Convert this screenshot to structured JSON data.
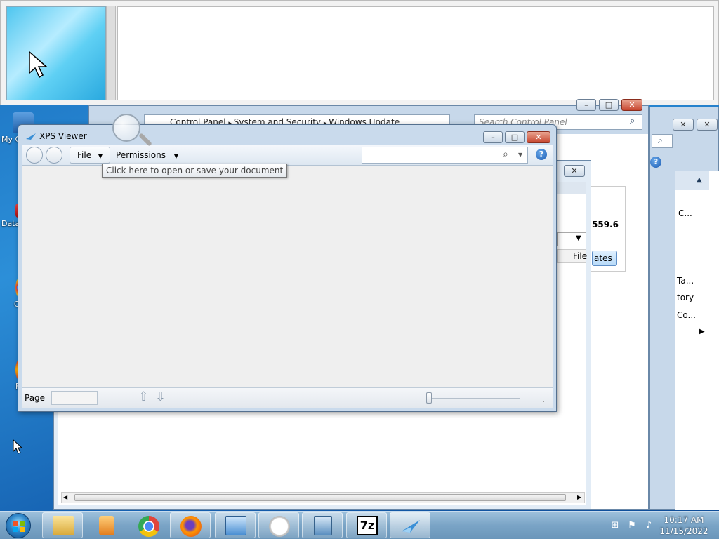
{
  "desktop": {
    "icons": [
      {
        "label": "My C"
      },
      {
        "label": "Data"
      },
      {
        "label": "C"
      },
      {
        "label": "F"
      }
    ]
  },
  "control_panel": {
    "breadcrumb": [
      "Control Panel",
      "System and Security",
      "Windows Update"
    ],
    "search_placeholder": "Search Control Panel",
    "value_text": "559.6",
    "button_text": "ates",
    "file_label": "File"
  },
  "right_window": {
    "items": [
      "C...",
      "Ta...",
      "tory",
      "Co..."
    ]
  },
  "xps_viewer": {
    "title": "XPS Viewer",
    "menu_file": "File",
    "menu_permissions": "Permissions",
    "tooltip": "Click here to open or save your document",
    "page_label": "Page",
    "help_symbol": "?"
  },
  "taskbar": {
    "time": "10:17 AM",
    "date": "11/15/2022",
    "apps": [
      "file-explorer",
      "media-player",
      "chrome",
      "firefox",
      "control-panel",
      "clock",
      "remote-desktop",
      "7zip",
      "xps-viewer"
    ]
  },
  "colors": {
    "accent": "#1a6fbf",
    "close_red": "#c7462f"
  }
}
